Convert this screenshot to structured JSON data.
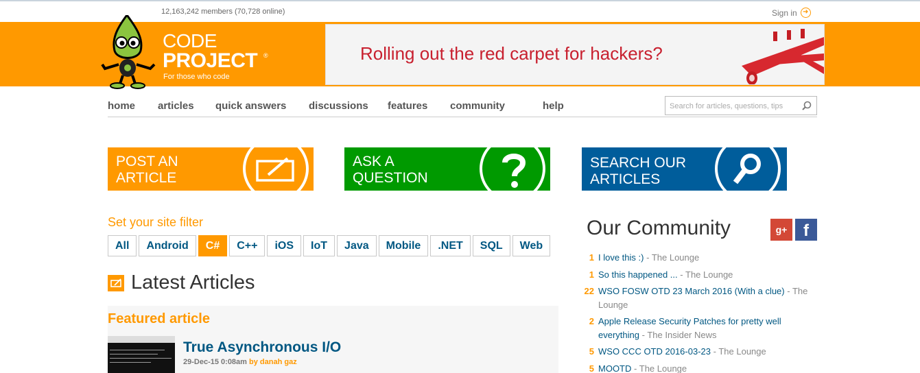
{
  "header": {
    "members": "12,163,242 members (70,728 online)",
    "sign_in": "Sign in"
  },
  "logo": {
    "line1": "CODE",
    "line2": "PROJECT",
    "reg": "®",
    "tagline": "For those who code"
  },
  "ad": {
    "text": "Rolling out the red carpet for hackers?"
  },
  "nav": {
    "items": [
      "home",
      "articles",
      "quick answers",
      "discussions",
      "features",
      "community",
      "help"
    ]
  },
  "search": {
    "placeholder": "Search for articles, questions, tips"
  },
  "cta": {
    "post": "POST AN\nARTICLE",
    "ask": "ASK A\nQUESTION",
    "search": "SEARCH OUR\nARTICLES"
  },
  "filter": {
    "label": "Set your site filter",
    "options": [
      "All",
      "Android",
      "C#",
      "C++",
      "iOS",
      "IoT",
      "Java",
      "Mobile",
      ".NET",
      "SQL",
      "Web"
    ],
    "active": "C#"
  },
  "latest": {
    "title": "Latest Articles",
    "featured_label": "Featured article",
    "featured": {
      "title": "True Asynchronous I/O",
      "date": "29-Dec-15 0:08am",
      "by": "by",
      "author": "danah gaz"
    }
  },
  "community": {
    "title": "Our Community",
    "gplus": "g+",
    "fb": "f",
    "sep": "-",
    "items": [
      {
        "count": "1",
        "title": "I love this :)",
        "forum": "The Lounge"
      },
      {
        "count": "1",
        "title": "So this happened ...",
        "forum": "The Lounge"
      },
      {
        "count": "22",
        "title": "WSO FOSW OTD 23 March 2016 (With a clue)",
        "forum": "The Lounge"
      },
      {
        "count": "2",
        "title": "Apple Release Security Patches for pretty well everything",
        "forum": "The Insider News"
      },
      {
        "count": "5",
        "title": "WSO CCC OTD 2016-03-23",
        "forum": "The Lounge"
      },
      {
        "count": "5",
        "title": "MOOTD",
        "forum": "The Lounge"
      }
    ]
  },
  "colors": {
    "orange": "#ff9900",
    "green": "#009a00",
    "blue": "#005d9b",
    "link": "#005782"
  }
}
